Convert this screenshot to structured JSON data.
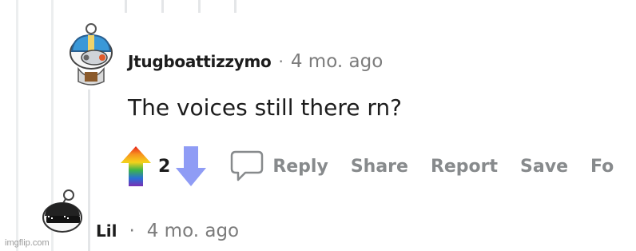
{
  "comment": {
    "author": "Jtugboattizzymo",
    "separator": "·",
    "time": "4 mo. ago",
    "body": "The voices still there rn?",
    "vote_count": "2",
    "actions": {
      "reply": "Reply",
      "share": "Share",
      "report": "Report",
      "save": "Save",
      "follow": "Fo"
    }
  },
  "reply_preview": {
    "author": "Lil",
    "separator": "·",
    "time": "4 mo. ago"
  },
  "watermark": "imgflip.com",
  "colors": {
    "upvote_gradient": [
      "#e8221c",
      "#f7931e",
      "#f5d11a",
      "#3cb44a",
      "#2a6fd6",
      "#7a2fb3"
    ],
    "downvote": "#8f9cf5",
    "muted": "#878a8c",
    "text": "#1c1c1c"
  }
}
